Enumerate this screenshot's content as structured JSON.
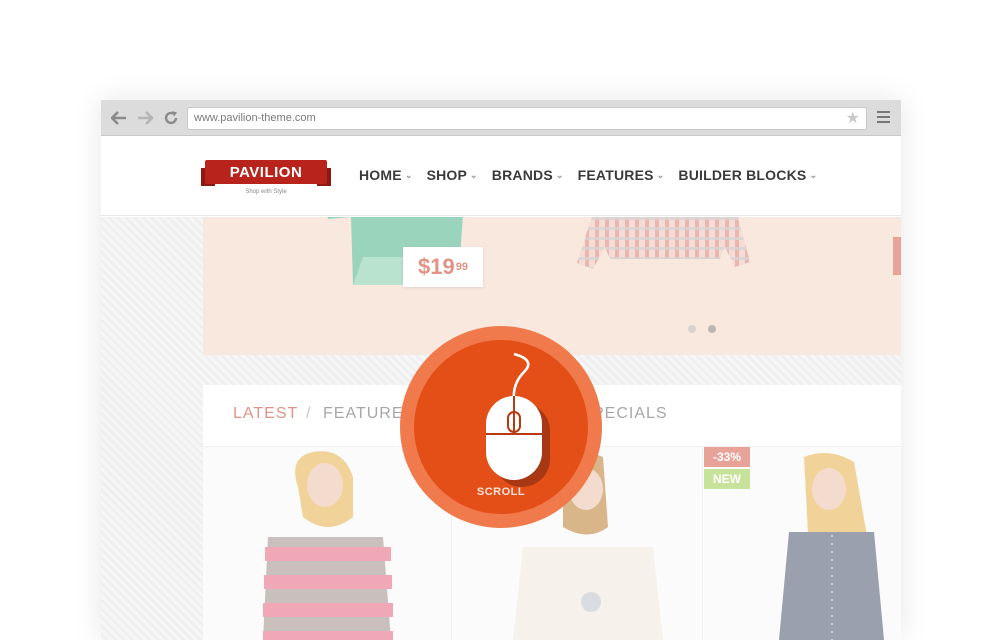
{
  "browser": {
    "url": "www.pavilion-theme.com",
    "icons": [
      "back-arrow-icon",
      "forward-arrow-icon",
      "reload-icon",
      "star-icon",
      "hamburger-menu-icon"
    ]
  },
  "site": {
    "logo_text": "PAVILION",
    "tagline": "Shop with Style",
    "nav": [
      "HOME",
      "SHOP",
      "BRANDS",
      "FEATURES",
      "BUILDER BLOCKS"
    ]
  },
  "hero": {
    "price_main": "$19",
    "price_cents": "99",
    "slides_total": 2,
    "slide_active": 2
  },
  "tabs": {
    "latest": "LATEST",
    "separator": "/",
    "featured": "FEATURE",
    "specials": "PECIALS"
  },
  "products": {
    "badge_discount": "-33%",
    "badge_new": "NEW"
  },
  "scroll_badge": {
    "label": "SCROLL",
    "icon": "mouse-icon"
  },
  "colors": {
    "accent": "#e44e17",
    "accent_ring": "#f07a4b",
    "logo_red": "#b8231b",
    "tab_active": "#e39386",
    "badge_new": "#c7e29a",
    "badge_discount": "#e8a398"
  }
}
